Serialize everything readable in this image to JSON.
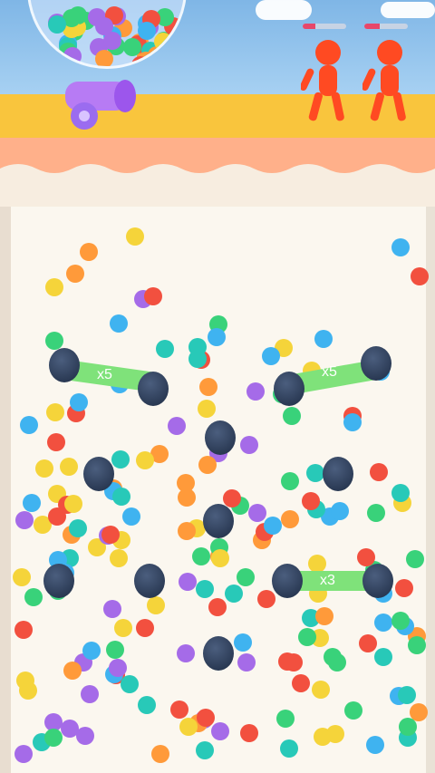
{
  "scene": {
    "multipliers": [
      "x5",
      "x5",
      "x3"
    ],
    "enemies": [
      {
        "name": "runner-1",
        "health": 0.3
      },
      {
        "name": "runner-2",
        "health": 0.35
      }
    ],
    "colors": {
      "ball_palette": [
        "#f2503f",
        "#39d27a",
        "#3fb3f0",
        "#f5d43a",
        "#a56be8",
        "#ff9a3a",
        "#28c9b8"
      ],
      "peg": "#1f2d45",
      "multiplier_bar": "#7fe27a",
      "enemy": "#ff4a22",
      "cannon": "#b77bf4"
    }
  }
}
